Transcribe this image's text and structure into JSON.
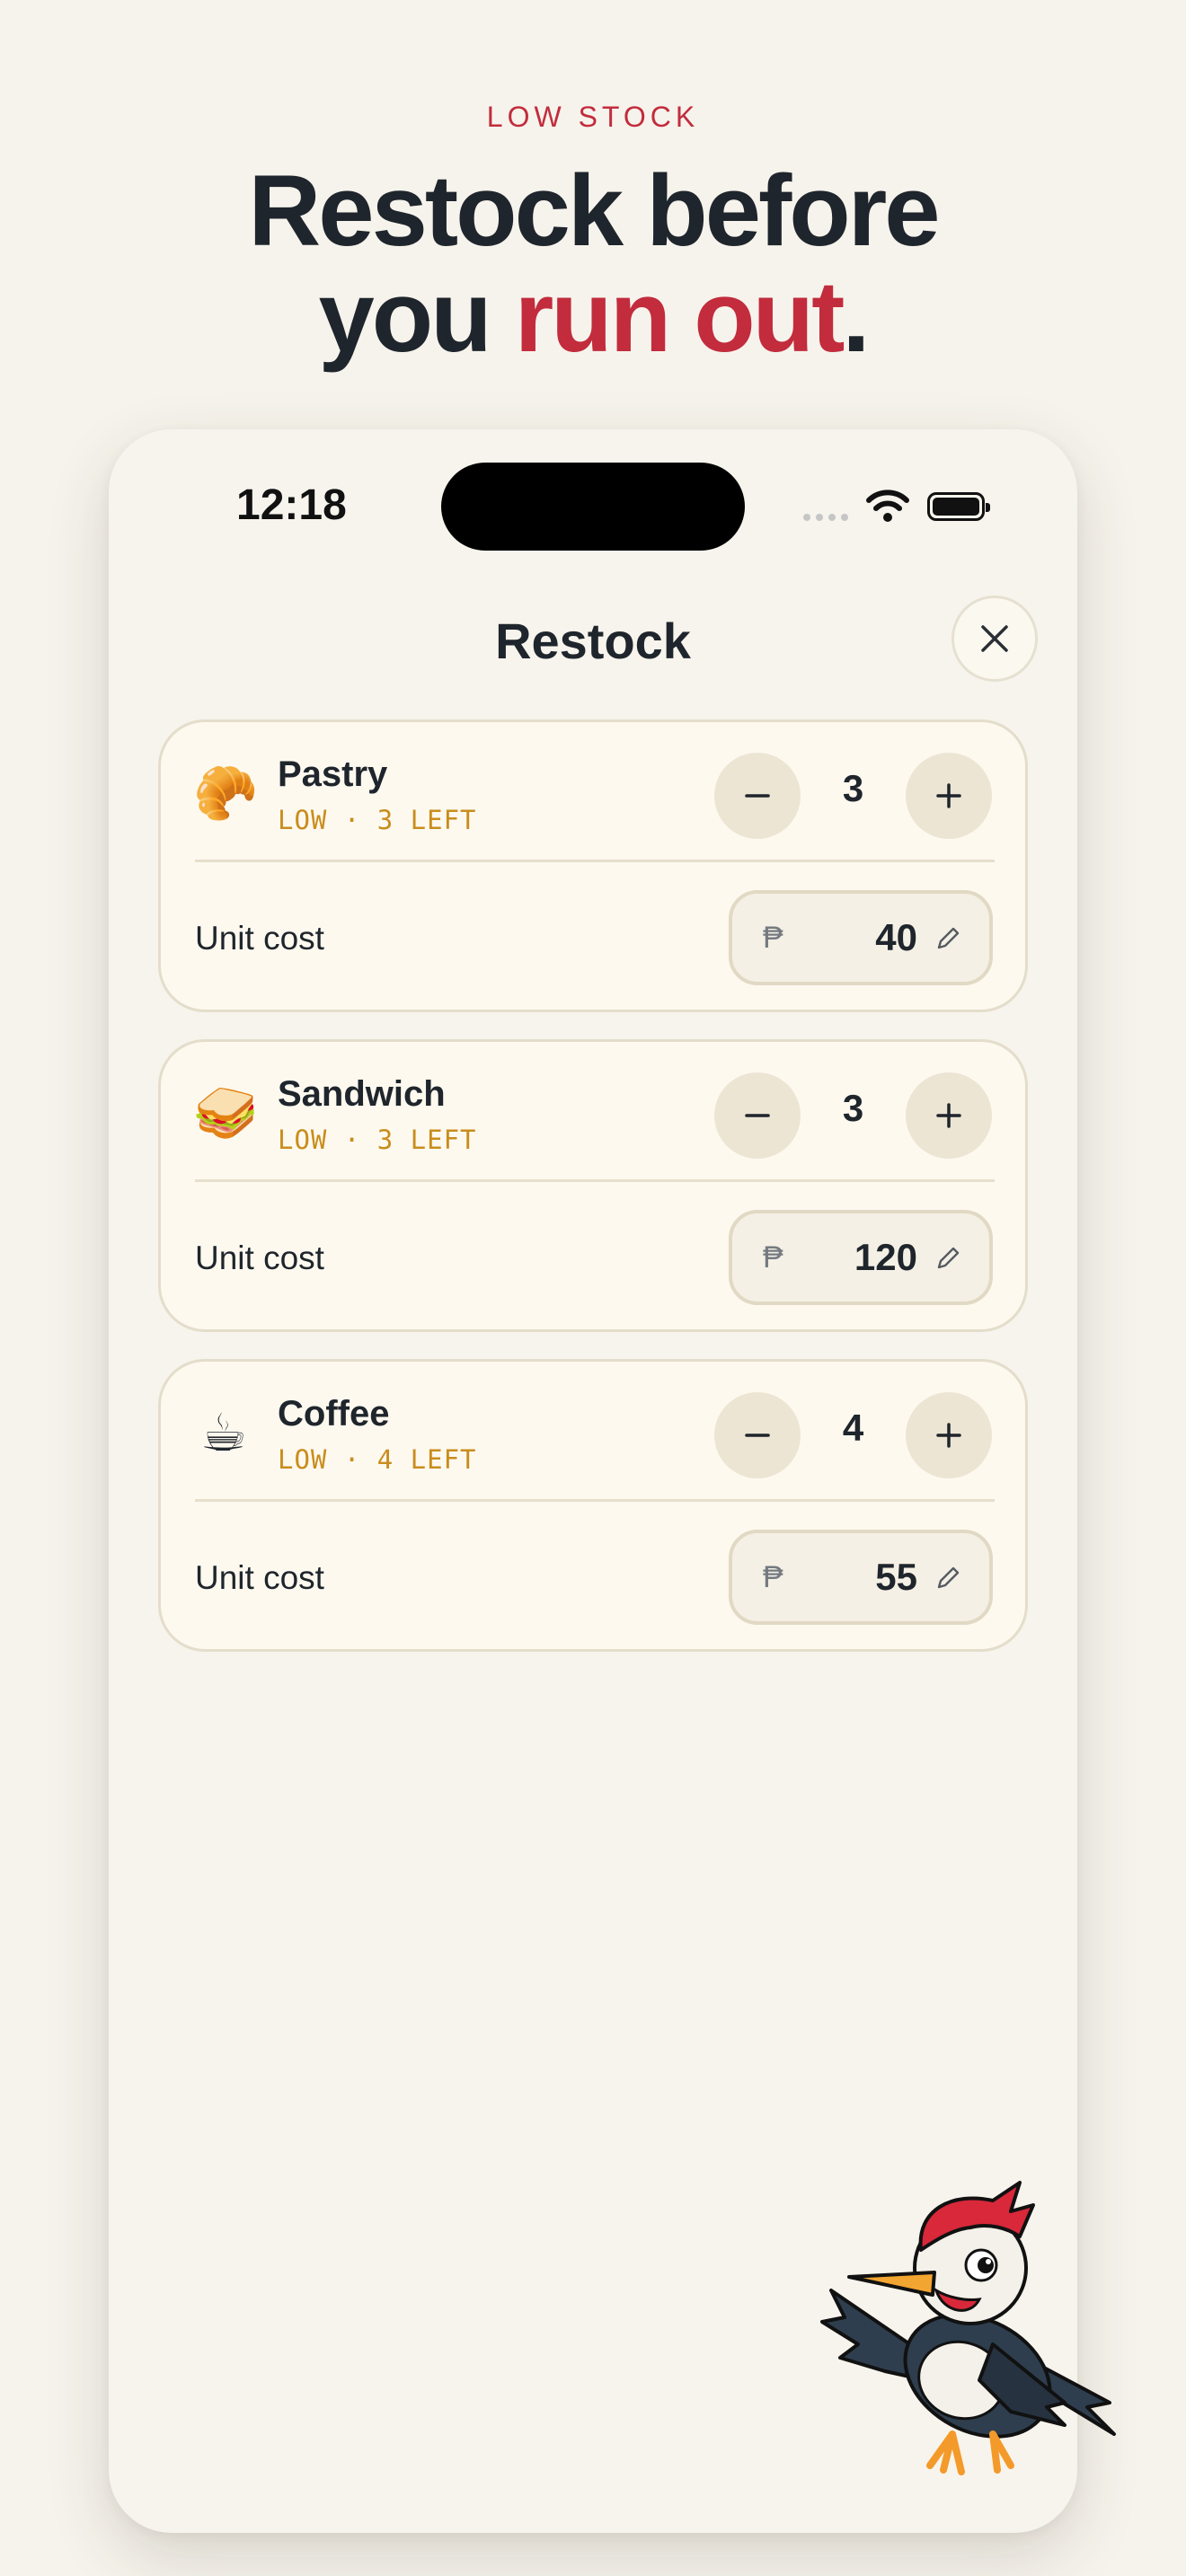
{
  "hero": {
    "eyebrow": "LOW STOCK",
    "headline_line1": "Restock before",
    "headline_line2_pre": "you ",
    "headline_line2_accent": "run out",
    "headline_line2_post": "."
  },
  "status_bar": {
    "time": "12:18"
  },
  "sheet": {
    "title": "Restock"
  },
  "items": [
    {
      "emoji": "🥐",
      "name": "Pastry",
      "stock_label": "LOW · 3 LEFT",
      "quantity": "3",
      "cost_label": "Unit cost",
      "currency": "₱",
      "unit_cost": "40"
    },
    {
      "emoji": "🥪",
      "name": "Sandwich",
      "stock_label": "LOW · 3 LEFT",
      "quantity": "3",
      "cost_label": "Unit cost",
      "currency": "₱",
      "unit_cost": "120"
    },
    {
      "emoji": "☕",
      "name": "Coffee",
      "stock_label": "LOW · 4 LEFT",
      "quantity": "4",
      "cost_label": "Unit cost",
      "currency": "₱",
      "unit_cost": "55"
    }
  ],
  "colors": {
    "accent": "#c22c3d",
    "stock_warning": "#c98d1c",
    "text": "#1f252c",
    "background": "#f6f3ec"
  },
  "icons": {
    "close": "close-icon",
    "minus": "minus-icon",
    "plus": "plus-icon",
    "edit": "pencil-icon",
    "mascot": "woodpecker-mascot"
  }
}
